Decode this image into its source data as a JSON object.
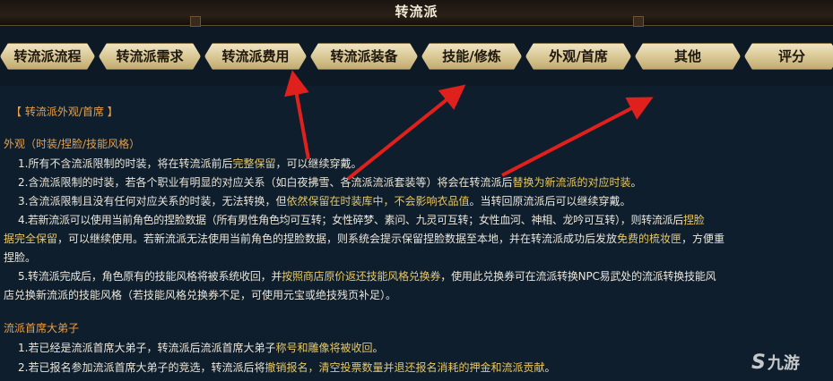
{
  "header": {
    "title": "转流派"
  },
  "tabs": [
    {
      "label": "转流派流程"
    },
    {
      "label": "转流派需求"
    },
    {
      "label": "转流派费用"
    },
    {
      "label": "转流派装备"
    },
    {
      "label": "技能/修炼"
    },
    {
      "label": "外观/首席"
    },
    {
      "label": "其他"
    },
    {
      "label": "评分"
    }
  ],
  "content": {
    "section_header": "【 转流派外观/首席 】",
    "appearance": {
      "title": "外观（时装/捏脸/技能风格）",
      "line1": {
        "a": "1.所有不含流派限制的时装，将在转流派前后",
        "b": "完整保留",
        "c": "，可以继续穿戴。"
      },
      "line2": {
        "a": "2.含流派限制的时装，若各个职业有明显的对应关系（如白夜拂雪、各流派流派套装等）将会在转流派后",
        "b": "替换为新流派的对应时装",
        "c": "。"
      },
      "line3": {
        "a": "3.含流派限制且没有任何对应关系的时装，无法转换，但",
        "b": "依然保留在时装库中，不会影响衣品值",
        "c": "。当转回原流派后可以继续穿戴。"
      },
      "line4a": {
        "a": "4.若新流派可以使用当前角色的捏脸数据（所有男性角色均可互转；女性碎梦、素问、九灵可互转；女性血河、神相、龙吟可互转），则转流派后",
        "b": "捏脸"
      },
      "line4b": {
        "a": "据完全保留",
        "b": "，可以继续使用。若新流派无法使用当前角色的捏脸数据，则系统会提示保留捏脸数据至本地，并在转流派成功后发放",
        "c": "免费的梳妆匣",
        "d": "，方便重"
      },
      "line4c": "捏脸。",
      "line5a": {
        "a": "5.转流派完成后，角色原有的技能风格将被系统收回，并",
        "b": "按照商店原价返还技能风格兑换券",
        "c": "，使用此兑换券可在流派转换NPC易武处的流派转换技能风"
      },
      "line5b": "店兑换新流派的技能风格（若技能风格兑换券不足，可使用元宝或绝技残页补足）。"
    },
    "chief": {
      "title": "流派首席大弟子",
      "line1": {
        "a": "1.若已经是流派首席大弟子，转流派后流派首席大弟子",
        "b": "称号和雕像将被收回",
        "c": "。"
      },
      "line2": {
        "a": "2.若已报名参加流派首席大弟子的竞选，转流派后将",
        "b": "撤销报名，清空投票数量并退还报名消耗的押金和流派贡献",
        "c": "。"
      }
    }
  },
  "watermark": {
    "mark": "S",
    "text": "九游"
  },
  "colors": {
    "highlight": "#e8c860",
    "heading": "#e8a048",
    "arrow": "#e0201c",
    "tab_bg": "#dccb95"
  }
}
